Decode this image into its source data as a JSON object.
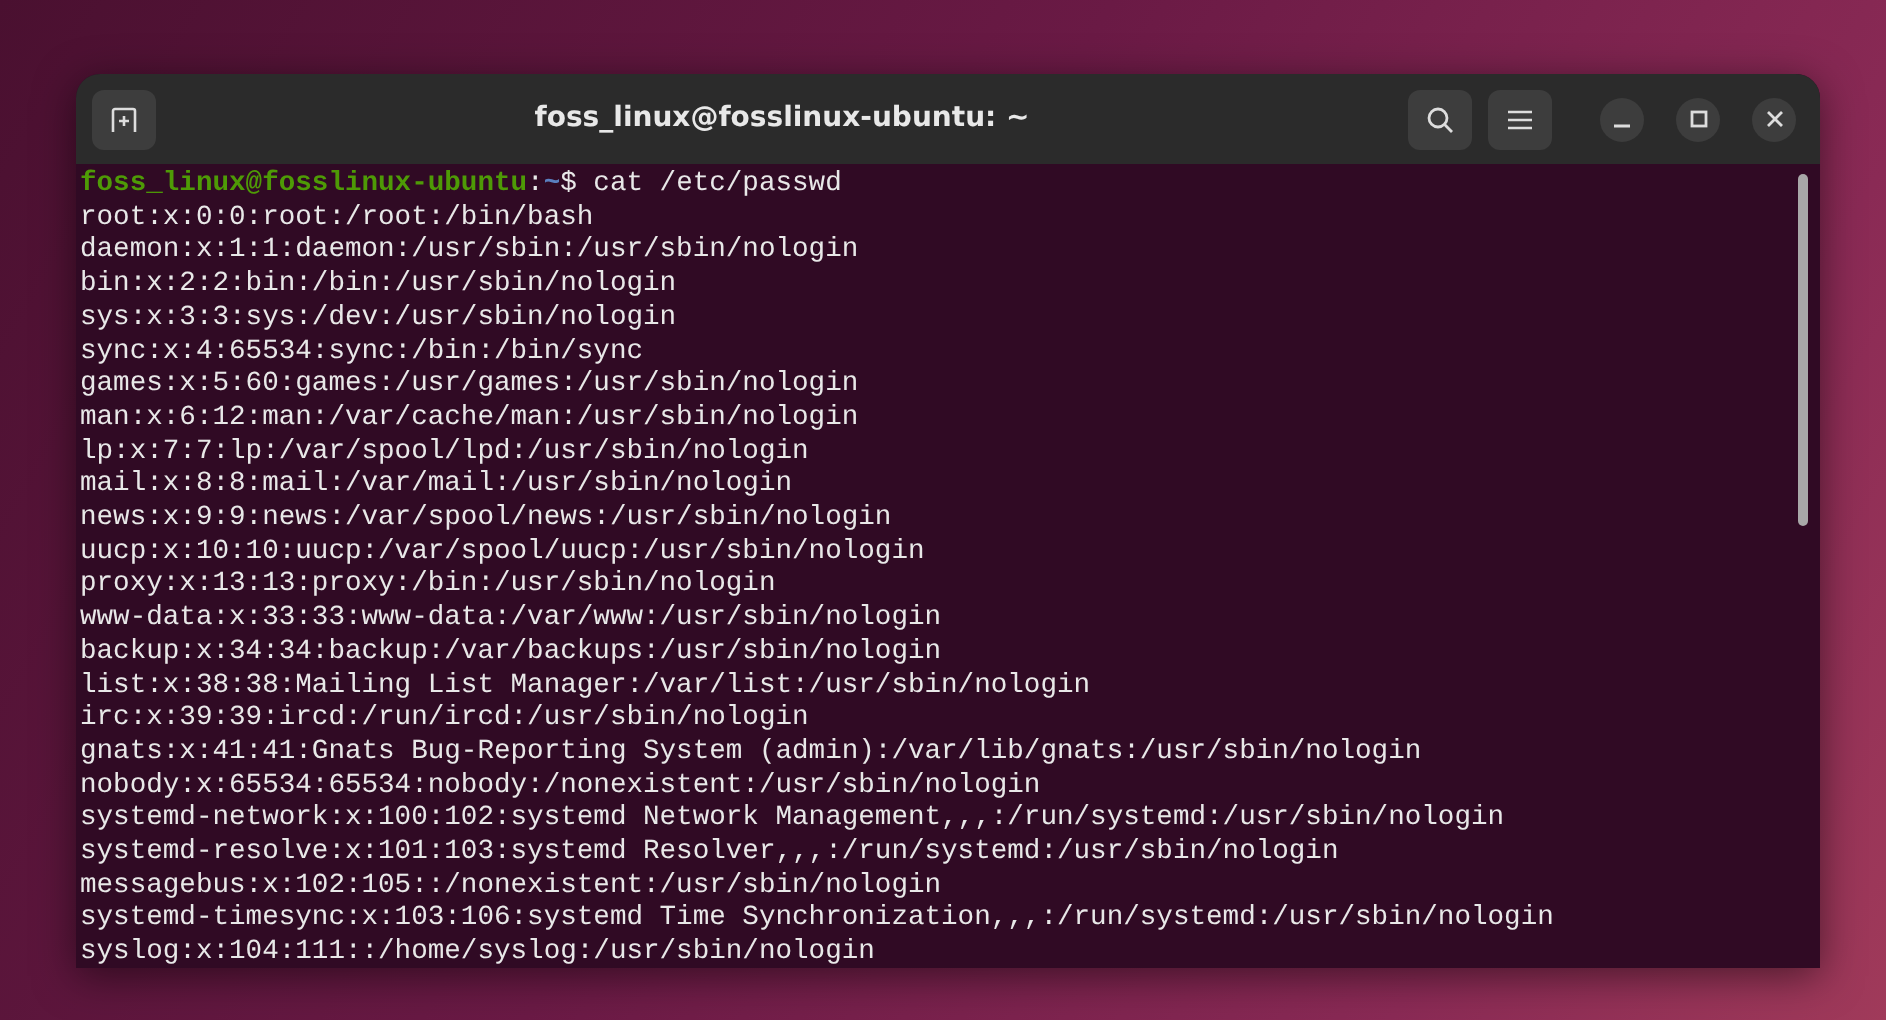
{
  "window": {
    "title": "foss_linux@fosslinux-ubuntu: ~"
  },
  "terminal": {
    "prompt": {
      "user_host": "foss_linux@fosslinux-ubuntu",
      "separator": ":",
      "path": "~",
      "symbol": "$",
      "command": "cat /etc/passwd"
    },
    "output": [
      "root:x:0:0:root:/root:/bin/bash",
      "daemon:x:1:1:daemon:/usr/sbin:/usr/sbin/nologin",
      "bin:x:2:2:bin:/bin:/usr/sbin/nologin",
      "sys:x:3:3:sys:/dev:/usr/sbin/nologin",
      "sync:x:4:65534:sync:/bin:/bin/sync",
      "games:x:5:60:games:/usr/games:/usr/sbin/nologin",
      "man:x:6:12:man:/var/cache/man:/usr/sbin/nologin",
      "lp:x:7:7:lp:/var/spool/lpd:/usr/sbin/nologin",
      "mail:x:8:8:mail:/var/mail:/usr/sbin/nologin",
      "news:x:9:9:news:/var/spool/news:/usr/sbin/nologin",
      "uucp:x:10:10:uucp:/var/spool/uucp:/usr/sbin/nologin",
      "proxy:x:13:13:proxy:/bin:/usr/sbin/nologin",
      "www-data:x:33:33:www-data:/var/www:/usr/sbin/nologin",
      "backup:x:34:34:backup:/var/backups:/usr/sbin/nologin",
      "list:x:38:38:Mailing List Manager:/var/list:/usr/sbin/nologin",
      "irc:x:39:39:ircd:/run/ircd:/usr/sbin/nologin",
      "gnats:x:41:41:Gnats Bug-Reporting System (admin):/var/lib/gnats:/usr/sbin/nologin",
      "nobody:x:65534:65534:nobody:/nonexistent:/usr/sbin/nologin",
      "systemd-network:x:100:102:systemd Network Management,,,:/run/systemd:/usr/sbin/nologin",
      "systemd-resolve:x:101:103:systemd Resolver,,,:/run/systemd:/usr/sbin/nologin",
      "messagebus:x:102:105::/nonexistent:/usr/sbin/nologin",
      "systemd-timesync:x:103:106:systemd Time Synchronization,,,:/run/systemd:/usr/sbin/nologin",
      "syslog:x:104:111::/home/syslog:/usr/sbin/nologin"
    ]
  }
}
